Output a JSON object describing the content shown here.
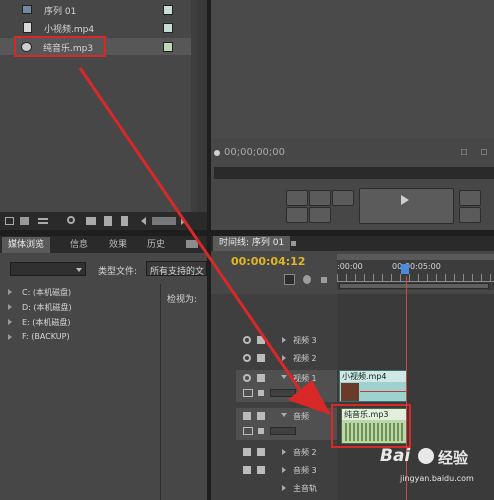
{
  "project_panel": {
    "items": [
      {
        "name": "序列 01",
        "icon": "sequence-icon",
        "swatch": "#c8dcd8"
      },
      {
        "name": "小视频.mp4",
        "icon": "video-file-icon",
        "swatch": "#c8dcd8"
      },
      {
        "name": "纯音乐.mp3",
        "icon": "audio-file-icon",
        "swatch": "#bfd6b4"
      }
    ]
  },
  "program_monitor": {
    "timecode": "00;00;00;00"
  },
  "media_browser": {
    "tabs": [
      "媒体浏览",
      "信息",
      "效果",
      "历史"
    ],
    "type_label": "类型文件:",
    "type_value": "所有支持的文",
    "view_label": "检视为:",
    "drives": [
      "C: (本机磁盘)",
      "D: (本机磁盘)",
      "E: (本机磁盘)",
      "F: (BACKUP)"
    ]
  },
  "timeline": {
    "tab_label": "时间线: 序列 01",
    "timecode": "00:00:04:12",
    "ruler": [
      ":00:00",
      "00:00:05:00"
    ],
    "tracks": [
      "视频 3",
      "视频 2",
      "视频 1",
      "音频",
      "音频 2",
      "音频 3",
      "主音轨"
    ],
    "video_clip": "小视频.mp4",
    "audio_clip": "纯音乐.mp3"
  },
  "watermark": {
    "brand_left": "Bai",
    "brand_right": "经验",
    "url": "jingyan.baidu.com"
  },
  "colors": {
    "highlight": "#d92828",
    "timecode": "#e3b622"
  }
}
